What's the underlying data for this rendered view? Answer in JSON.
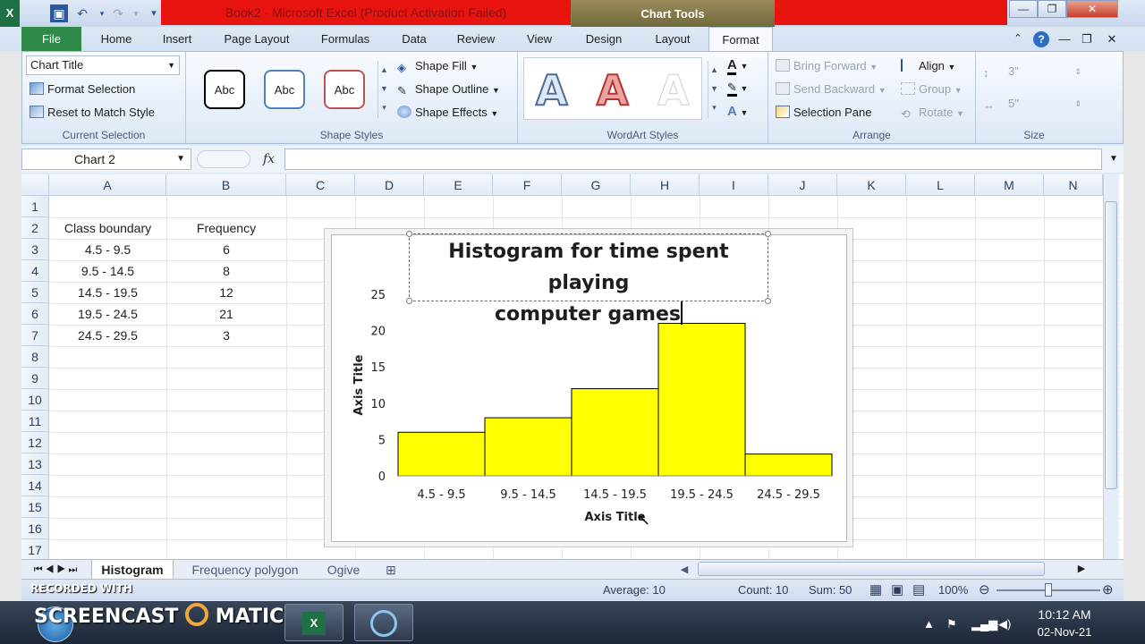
{
  "window": {
    "title": "Book2  -  Microsoft Excel (Product Activation Failed)",
    "context_tab": "Chart Tools"
  },
  "ribbon_tabs": [
    {
      "label": "File"
    },
    {
      "label": "Home"
    },
    {
      "label": "Insert"
    },
    {
      "label": "Page Layout"
    },
    {
      "label": "Formulas"
    },
    {
      "label": "Data"
    },
    {
      "label": "Review"
    },
    {
      "label": "View"
    },
    {
      "label": "Design"
    },
    {
      "label": "Layout"
    },
    {
      "label": "Format"
    }
  ],
  "ribbon": {
    "current_selection": {
      "dropdown_value": "Chart Title",
      "format_selection": "Format Selection",
      "reset_style": "Reset to Match Style",
      "label": "Current Selection"
    },
    "shape_styles": {
      "samples": [
        "Abc",
        "Abc",
        "Abc"
      ],
      "fill": "Shape Fill",
      "outline": "Shape Outline",
      "effects": "Shape Effects",
      "label": "Shape Styles",
      "sample_colors": [
        "#000000",
        "#4f81bd",
        "#c0504d"
      ]
    },
    "wordart_styles": {
      "letters": [
        "A",
        "A",
        "A"
      ],
      "label": "WordArt Styles"
    },
    "arrange": {
      "bring_forward": "Bring Forward",
      "send_backward": "Send Backward",
      "selection_pane": "Selection Pane",
      "align": "Align",
      "group": "Group",
      "rotate": "Rotate",
      "label": "Arrange"
    },
    "size": {
      "height": "3\"",
      "width": "5\"",
      "label": "Size"
    }
  },
  "formula_bar": {
    "name_box": "Chart 2",
    "fx": "fx",
    "value": ""
  },
  "sheet": {
    "columns": [
      "A",
      "B",
      "C",
      "D",
      "E",
      "F",
      "G",
      "H",
      "I",
      "J",
      "K",
      "L",
      "M",
      "N"
    ],
    "rows": [
      "1",
      "2",
      "3",
      "4",
      "5",
      "6",
      "7",
      "8",
      "9",
      "10",
      "11",
      "12",
      "13",
      "14",
      "15",
      "16",
      "17"
    ],
    "header_row": {
      "a": "Class boundary",
      "b": "Frequency"
    },
    "data_rows": [
      {
        "a": "4.5 - 9.5",
        "b": "6"
      },
      {
        "a": "9.5 - 14.5",
        "b": "8"
      },
      {
        "a": "14.5 - 19.5",
        "b": "12"
      },
      {
        "a": "19.5 - 24.5",
        "b": "21"
      },
      {
        "a": "24.5 - 29.5",
        "b": "3"
      }
    ]
  },
  "chart_data": {
    "type": "bar",
    "title": "Histogram for time spent playing computer games",
    "title_lines": [
      "Histogram for time spent playing",
      "computer games"
    ],
    "categories": [
      "4.5 - 9.5",
      "9.5 - 14.5",
      "14.5 - 19.5",
      "19.5 - 24.5",
      "24.5 - 29.5"
    ],
    "values": [
      6,
      8,
      12,
      21,
      3
    ],
    "xlabel": "Axis Title",
    "ylabel": "Axis Title",
    "ylim": [
      0,
      25
    ],
    "yticks": [
      0,
      5,
      10,
      15,
      20,
      25
    ],
    "bar_color": "#ffff00",
    "bar_edge": "#000000",
    "grid": false,
    "legend": "none"
  },
  "sheet_tabs": [
    {
      "label": "Histogram",
      "active": true
    },
    {
      "label": "Frequency polygon",
      "active": false
    },
    {
      "label": "Ogive",
      "active": false
    }
  ],
  "status_bar": {
    "average": "Average: 10",
    "count": "Count: 10",
    "sum": "Sum: 50",
    "zoom": "100%"
  },
  "watermark": {
    "brand": "SCREENCAST",
    "brand_suffix": "MATIC",
    "recorded": "RECORDED WITH"
  },
  "taskbar": {
    "time": "10:12 AM",
    "date": "02-Nov-21"
  }
}
